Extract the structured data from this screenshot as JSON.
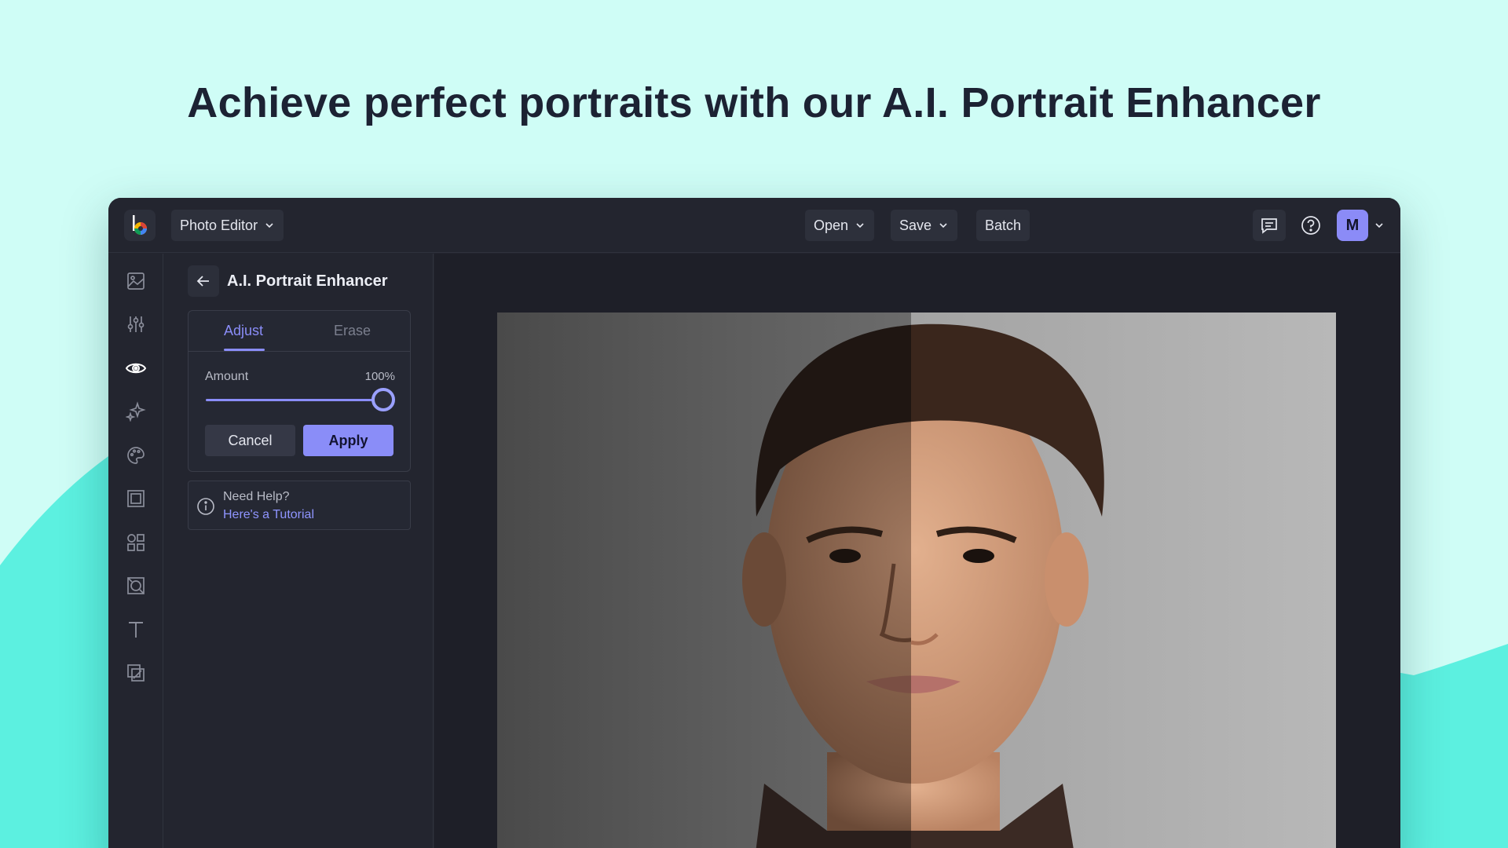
{
  "headline": "Achieve perfect portraits with our A.I. Portrait Enhancer",
  "colors": {
    "page_bg": "#cffdf6",
    "wave": "#5cf0e0",
    "app_bg": "#23252f",
    "accent": "#8a8df8"
  },
  "topbar": {
    "logo_icon": "befunky-logo-icon",
    "editor_menu": "Photo Editor",
    "open_menu": "Open",
    "save_menu": "Save",
    "batch_button": "Batch",
    "feedback_icon": "comment-icon",
    "help_icon": "question-circle-icon",
    "avatar_initial": "M",
    "account_menu_icon": "chevron-down-icon"
  },
  "sidebar": {
    "items": [
      {
        "icon": "image-icon",
        "active": false
      },
      {
        "icon": "sliders-icon",
        "active": false
      },
      {
        "icon": "eye-icon",
        "active": true
      },
      {
        "icon": "sparkles-icon",
        "active": false
      },
      {
        "icon": "palette-icon",
        "active": false
      },
      {
        "icon": "frame-icon",
        "active": false
      },
      {
        "icon": "shapes-icon",
        "active": false
      },
      {
        "icon": "texture-icon",
        "active": false
      },
      {
        "icon": "text-icon",
        "active": false
      },
      {
        "icon": "layers-icon",
        "active": false
      }
    ]
  },
  "panel": {
    "back_icon": "arrow-left-icon",
    "title": "A.I. Portrait Enhancer",
    "tabs": [
      {
        "label": "Adjust",
        "active": true
      },
      {
        "label": "Erase",
        "active": false
      }
    ],
    "amount_label": "Amount",
    "amount_value": "100%",
    "amount_level": 1.0,
    "cancel_label": "Cancel",
    "apply_label": "Apply",
    "help_icon": "info-circle-icon",
    "help_prompt": "Need Help?",
    "help_link": "Here's a Tutorial"
  },
  "canvas": {
    "image": "portrait-before-after-photo",
    "comparison": "split before/after"
  }
}
